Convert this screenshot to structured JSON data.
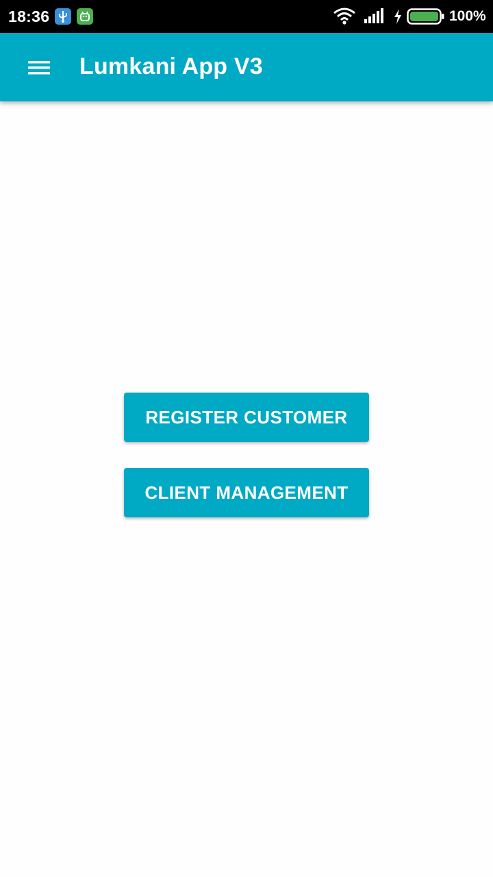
{
  "status_bar": {
    "time": "18:36",
    "notifications": [
      "usb-debug-icon",
      "android-icon"
    ],
    "icons": [
      "wifi-icon",
      "signal-icon",
      "charging-icon",
      "battery-icon"
    ],
    "battery_level": "100%"
  },
  "app_bar": {
    "title": "Lumkani App V3",
    "nav_icon": "menu-icon"
  },
  "main": {
    "buttons": [
      {
        "label": "REGISTER CUSTOMER"
      },
      {
        "label": "CLIENT MANAGEMENT"
      }
    ]
  },
  "colors": {
    "primary": "#00a9c4",
    "status_bar": "#000000",
    "background": "#fefefe",
    "battery": "#4caf50"
  }
}
